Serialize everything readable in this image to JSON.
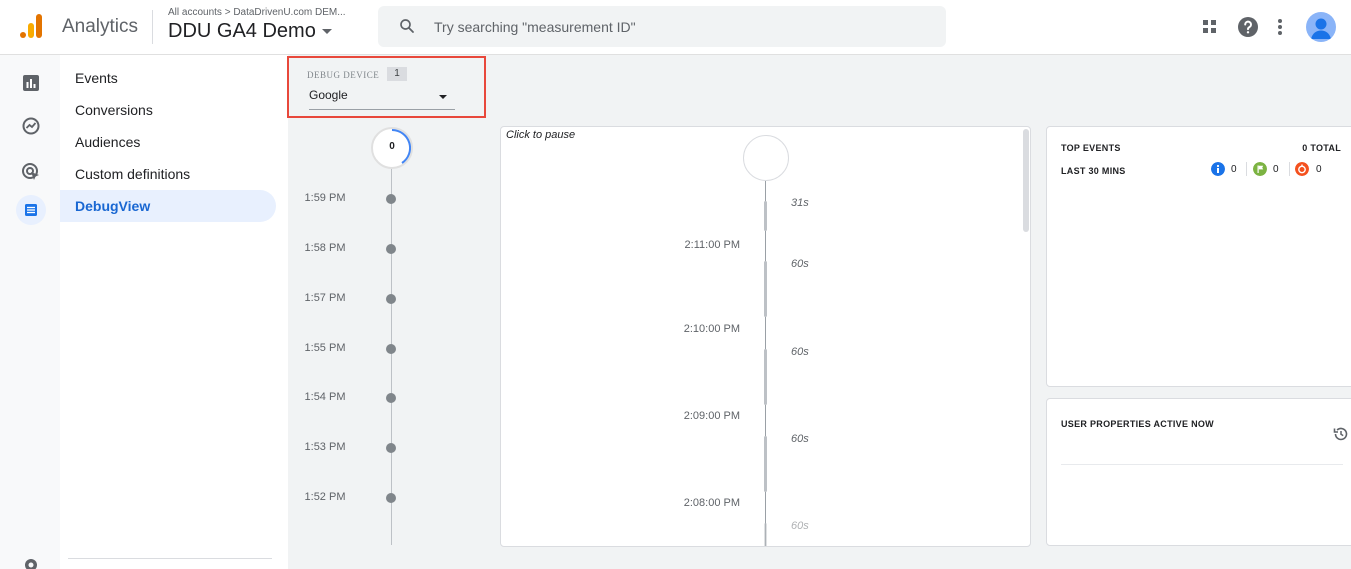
{
  "header": {
    "app_title": "Analytics",
    "breadcrumb": "All accounts > DataDrivenU.com DEM...",
    "property_name": "DDU GA4 Demo",
    "search_placeholder": "Try searching \"measurement ID\""
  },
  "sidebar": {
    "items": [
      {
        "label": "Events"
      },
      {
        "label": "Conversions"
      },
      {
        "label": "Audiences"
      },
      {
        "label": "Custom definitions"
      },
      {
        "label": "DebugView",
        "active": true
      }
    ]
  },
  "debug_device": {
    "label": "DEBUG DEVICE",
    "count": "1",
    "selected": "Google"
  },
  "minutes_stream": {
    "count": "0",
    "times": [
      "1:59 PM",
      "1:58 PM",
      "1:57 PM",
      "1:55 PM",
      "1:54 PM",
      "1:53 PM",
      "1:52 PM"
    ]
  },
  "seconds_stream": {
    "pause_label": "Click to pause",
    "timestamps": [
      "2:11:00 PM",
      "2:10:00 PM",
      "2:09:00 PM",
      "2:08:00 PM"
    ],
    "durations": [
      "31s",
      "60s",
      "60s",
      "60s",
      "60s"
    ]
  },
  "top_events": {
    "title": "TOP EVENTS",
    "total": "0 TOTAL",
    "range": "LAST 30 MINS",
    "counts": [
      {
        "type": "blue",
        "color": "#1a73e8",
        "value": "0"
      },
      {
        "type": "green",
        "color": "#7cb342",
        "value": "0"
      },
      {
        "type": "orange",
        "color": "#f4511e",
        "value": "0"
      }
    ]
  },
  "user_properties": {
    "title": "USER PROPERTIES ACTIVE NOW"
  },
  "colors": {
    "accent": "#1a73e8",
    "highlight_border": "#e8483b",
    "logo_orange": "#e37400",
    "logo_yellow": "#f9ab00"
  }
}
